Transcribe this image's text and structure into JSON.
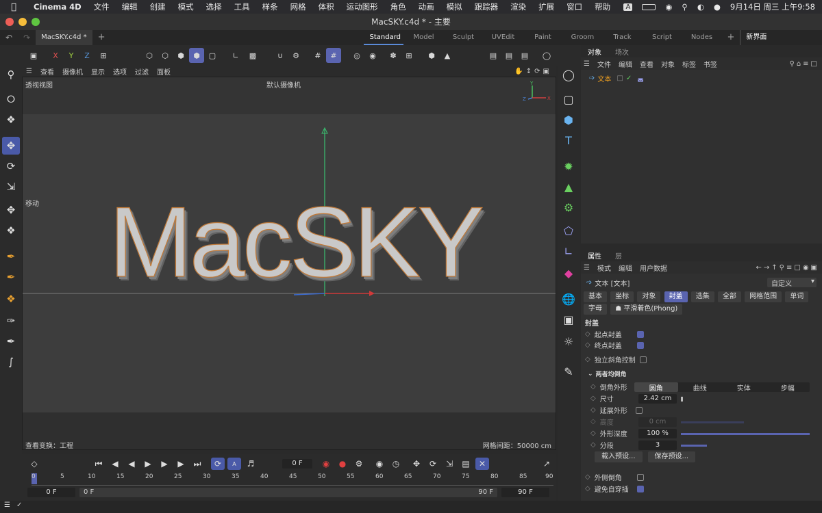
{
  "menubar": {
    "items": [
      "Cinema 4D",
      "文件",
      "编辑",
      "创建",
      "模式",
      "选择",
      "工具",
      "样条",
      "网格",
      "体积",
      "运动图形",
      "角色",
      "动画",
      "模拟",
      "跟踪器",
      "渲染",
      "扩展",
      "窗口",
      "帮助"
    ],
    "clock": "9月14日 周三 上午9:58",
    "input_method": "A"
  },
  "window": {
    "title": "MacSKY.c4d * - 主要"
  },
  "tabs": {
    "file_tab": "MacSKY.c4d *",
    "layouts": [
      "Standard",
      "Model",
      "Sculpt",
      "UVEdit",
      "Paint",
      "Groom",
      "Track",
      "Script",
      "Nodes"
    ],
    "active_layout": "Standard",
    "new_layout": "新界面"
  },
  "toolbar": {
    "x": "X",
    "y": "Y",
    "z": "Z"
  },
  "viewport": {
    "menu": [
      "查看",
      "摄像机",
      "显示",
      "选项",
      "过滤",
      "面板"
    ],
    "view_name": "透视视图",
    "camera": "默认摄像机",
    "tool_label": "移动",
    "bottom_left": "查看变换：工程",
    "bottom_right": "网格间距：50000 cm",
    "text_3d": "MacSKY"
  },
  "objects": {
    "tabs": [
      "对象",
      "场次"
    ],
    "menu": [
      "文件",
      "编辑",
      "查看",
      "对象",
      "标签",
      "书签"
    ],
    "item": "文本"
  },
  "attributes": {
    "tabs": [
      "属性",
      "层"
    ],
    "menu": [
      "模式",
      "编辑",
      "用户数据"
    ],
    "object": "文本 [文本]",
    "preset": "自定义",
    "chips": [
      "基本",
      "坐标",
      "对象",
      "封盖",
      "选集",
      "全部",
      "网格范围",
      "单词"
    ],
    "chips2": [
      "字母",
      "平滑着色(Phong)"
    ],
    "active_chip": "封盖",
    "section": "封盖",
    "start_cap": "起点封盖",
    "end_cap": "终点封盖",
    "independent": "独立斜角控制",
    "group": "两者均倒角",
    "shape_label": "倒角外形",
    "shapes": [
      "圆角",
      "曲线",
      "实体",
      "步幅"
    ],
    "size_label": "尺寸",
    "size_value": "2.42 cm",
    "extend_label": "延展外形",
    "height_label": "高度",
    "height_value": "0 cm",
    "depth_label": "外形深度",
    "depth_value": "100 %",
    "segments_label": "分段",
    "segments_value": "3",
    "load_preset": "载入预设...",
    "save_preset": "保存预设...",
    "outer_bevel": "外侧倒角",
    "avoid": "避免自穿插"
  },
  "timeline": {
    "frame": "0 F",
    "ticks": [
      "0",
      "5",
      "10",
      "15",
      "20",
      "25",
      "30",
      "35",
      "40",
      "45",
      "50",
      "55",
      "60",
      "65",
      "70",
      "75",
      "80",
      "85",
      "90"
    ],
    "start": "0 F",
    "range_start": "0 F",
    "range_end": "90 F",
    "end": "90 F"
  }
}
